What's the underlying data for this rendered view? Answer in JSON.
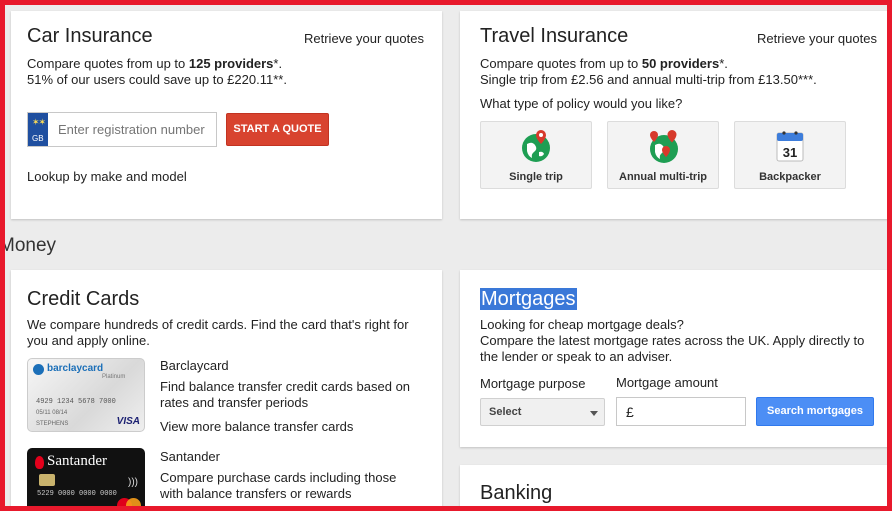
{
  "car": {
    "title": "Car Insurance",
    "retrieve": "Retrieve your quotes",
    "line1_pre": "Compare quotes from up to ",
    "line1_bold": "125 providers",
    "line1_post": "*.",
    "line2": "51% of our users could save up to £220.11**.",
    "gb": "GB",
    "reg_placeholder": "Enter registration number",
    "start_button": "START A QUOTE",
    "lookup_link": "Lookup by make and model"
  },
  "travel": {
    "title": "Travel Insurance",
    "retrieve": "Retrieve your quotes",
    "line1_pre": "Compare quotes from up to ",
    "line1_bold": "50 providers",
    "line1_post": "*.",
    "line2": "Single trip from £2.56 and annual multi-trip from £13.50***.",
    "question": "What type of policy would you like?",
    "tiles": [
      {
        "label": "Single trip",
        "icon": "globe-pin-icon"
      },
      {
        "label": "Annual multi-trip",
        "icon": "globe-multi-pin-icon"
      },
      {
        "label": "Backpacker",
        "icon": "calendar-icon",
        "calendar_day": "31"
      }
    ]
  },
  "section": {
    "money_heading": "Money"
  },
  "credit": {
    "title": "Credit Cards",
    "intro": "We compare hundreds of credit cards. Find the card that's right for you and apply online.",
    "items": [
      {
        "name": "Barclaycard",
        "desc": "Find balance transfer credit cards based on rates and transfer periods",
        "more": "View more balance transfer cards",
        "card_brand": "barclaycard",
        "card_tier": "Platinum",
        "card_number": "4929 1234 5678 7000",
        "card_dates": "05/11  08/14",
        "card_holder": "STEPHENS",
        "card_network": "VISA"
      },
      {
        "name": "Santander",
        "desc": "Compare purchase cards including those with balance transfers or rewards",
        "card_brand": "Santander",
        "card_number": "5229 0000 0000 0000"
      }
    ]
  },
  "mortgage": {
    "title": "Mortgages",
    "line1": "Looking for cheap mortgage deals?",
    "line2": "Compare the latest mortgage rates across the UK. Apply directly to the lender or speak to an adviser.",
    "purpose_label": "Mortgage purpose",
    "amount_label": "Mortgage amount",
    "select_value": "Select",
    "currency": "£",
    "search_button": "Search mortgages"
  },
  "banking": {
    "title": "Banking"
  }
}
